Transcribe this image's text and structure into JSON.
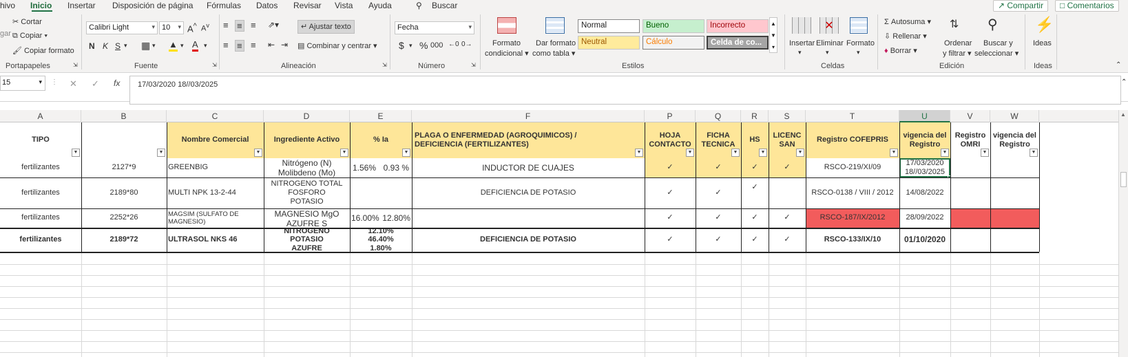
{
  "menu": {
    "items": [
      "hivo",
      "Inicio",
      "Insertar",
      "Disposición de página",
      "Fórmulas",
      "Datos",
      "Revisar",
      "Vista",
      "Ayuda",
      "Buscar"
    ],
    "share": "Compartir",
    "comments": "Comentarios"
  },
  "ribbon": {
    "clipboard": {
      "cut": "Cortar",
      "copy": "Copiar",
      "copy_format": "Copiar formato",
      "paste": "gar",
      "label": "Portapapeles"
    },
    "font": {
      "name": "Calibri Light",
      "size": "10",
      "bold": "N",
      "italic": "K",
      "underline": "S",
      "label": "Fuente"
    },
    "alignment": {
      "wrap": "Ajustar texto",
      "merge": "Combinar y centrar",
      "label": "Alineación"
    },
    "number": {
      "format": "Fecha",
      "currency": "$",
      "percent": "%",
      "thousands": "000",
      "label": "Número"
    },
    "styles": {
      "cond_format": [
        "Formato",
        "condicional"
      ],
      "table_format": [
        "Dar formato",
        "como tabla"
      ],
      "normal": "Normal",
      "good": "Bueno",
      "bad": "Incorrecto",
      "neutral": "Neutral",
      "calc": "Cálculo",
      "check": "Celda de co...",
      "label": "Estilos"
    },
    "cells": {
      "insert": "Insertar",
      "delete": "Eliminar",
      "format": "Formato",
      "label": "Celdas"
    },
    "editing": {
      "autosum": "Autosuma",
      "fill": "Rellenar",
      "clear": "Borrar",
      "sort": [
        "Ordenar",
        "y filtrar"
      ],
      "find": [
        "Buscar y",
        "seleccionar"
      ],
      "label": "Edición"
    },
    "ideas": {
      "button": "Ideas",
      "label": "Ideas"
    }
  },
  "formula_bar": {
    "name_box": "15",
    "content": "17/03/2020 18//03/2025"
  },
  "columns": [
    "A",
    "B",
    "C",
    "D",
    "E",
    "F",
    "P",
    "Q",
    "R",
    "S",
    "T",
    "U",
    "V",
    "W"
  ],
  "headers": {
    "tipo": "TIPO",
    "nombre": "Nombre Comercial",
    "ingrediente": "Ingrediente Activo",
    "ia": "% Ia",
    "plaga": [
      "PLAGA O ENFERMEDAD (AGROQUIMICOS) /",
      "DEFICIENCIA (FERTILIZANTES)"
    ],
    "hoja": [
      "HOJA",
      "CONTACTO"
    ],
    "ficha": [
      "FICHA",
      "TECNICA"
    ],
    "hs": "HS",
    "licenc": [
      "LICENC",
      "SAN"
    ],
    "cofepris": "Registro COFEPRIS",
    "vigencia": [
      "vigencia del",
      "Registro"
    ],
    "omri": [
      "Registro",
      "OMRI"
    ],
    "vigencia2": [
      "vigencia del",
      "Registro"
    ]
  },
  "rows": [
    {
      "tipo": "fertilizantes",
      "codigo": "2127*9",
      "nombre": "GREENBIG",
      "ingrediente": [
        "Nitrógeno (N)",
        "Molibdeno (Mo)"
      ],
      "ia": [
        "1.56%",
        "0.93 %"
      ],
      "plaga": "INDUCTOR DE CUAJES",
      "hoja": "✓",
      "ficha": "✓",
      "hs": "✓",
      "licenc": "✓",
      "cofepris": "RSCO-219/XI/09",
      "vigencia": [
        "17/03/2020",
        "18//03/2025"
      ]
    },
    {
      "tipo": "fertilizantes",
      "codigo": "2189*80",
      "nombre": "MULTI NPK 13-2-44",
      "ingrediente": [
        "NITROGENO TOTAL",
        "FOSFORO",
        "POTASIO"
      ],
      "ia": [],
      "plaga": "DEFICIENCIA DE POTASIO",
      "hoja": "✓",
      "ficha": "✓",
      "hs": "✓",
      "licenc": "",
      "cofepris": "RSCO-0138 / VIII / 2012",
      "vigencia": [
        "14/08/2022"
      ]
    },
    {
      "tipo": "fertilizantes",
      "codigo": "2252*26",
      "nombre": [
        "MAGSIM (SULFATO DE",
        "MAGNESIO)"
      ],
      "ingrediente": [
        "MAGNESIO MgO",
        "AZUFRE S"
      ],
      "ia": [
        "16.00%",
        "12.80%"
      ],
      "plaga": "",
      "hoja": "✓",
      "ficha": "✓",
      "hs": "✓",
      "licenc": "✓",
      "cofepris": "RSCO-187/IX/2012",
      "vigencia": [
        "28/09/2022"
      ]
    },
    {
      "tipo": "fertilizantes",
      "codigo": "2189*72",
      "nombre": "ULTRASOL NKS 46",
      "ingrediente": [
        "NITROGENO",
        "POTASIO",
        "AZUFRE"
      ],
      "ia": [
        "12.10%",
        "46.40%",
        "1.80%"
      ],
      "plaga": "DEFICIENCIA DE POTASIO",
      "hoja": "✓",
      "ficha": "✓",
      "hs": "✓",
      "licenc": "✓",
      "cofepris": "RSCO-133/IX/10",
      "vigencia": [
        "01/10/2020"
      ]
    }
  ]
}
